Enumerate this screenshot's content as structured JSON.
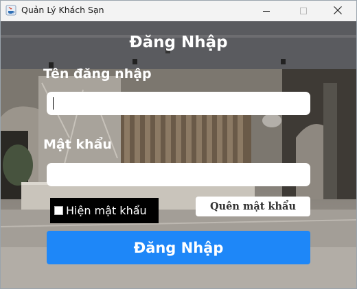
{
  "window": {
    "title": "Quản Lý Khách Sạn",
    "icons": {
      "app": "java-cup-icon",
      "minimize": "minimize-icon",
      "maximize": "maximize-icon",
      "close": "close-icon"
    }
  },
  "form": {
    "heading": "Đăng Nhập",
    "username_label": "Tên đăng nhập",
    "username_value": "",
    "password_label": "Mật khẩu",
    "password_value": "",
    "show_password_label": "Hiện mật khẩu",
    "show_password_checked": false,
    "forgot_label": "Quên mật khẩu",
    "login_label": "Đăng Nhập"
  },
  "colors": {
    "accent": "#1e87f8",
    "label_text": "#ffffff"
  }
}
